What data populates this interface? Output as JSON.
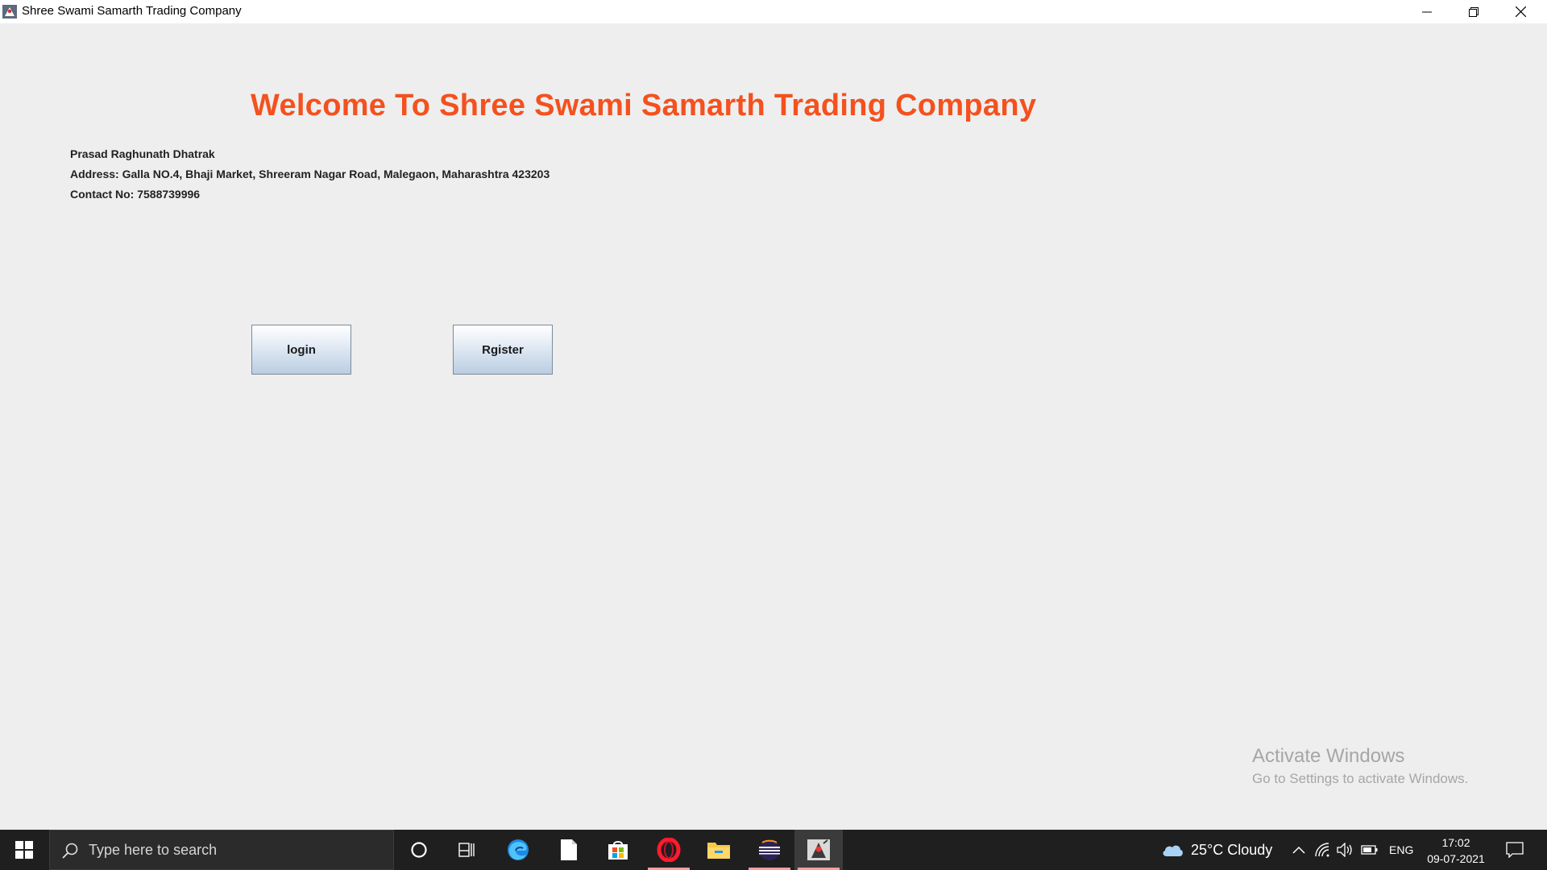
{
  "window": {
    "title": "Shree Swami Samarth Trading Company",
    "icons": {
      "app": "duke-java-icon",
      "minimize": "minimize-icon",
      "maximize": "restore-icon",
      "close": "close-icon"
    }
  },
  "main": {
    "welcome": "Welcome To Shree Swami Samarth Trading Company",
    "owner": "Prasad Raghunath Dhatrak",
    "address": "Address: Galla NO.4, Bhaji Market, Shreeram Nagar Road, Malegaon, Maharashtra 423203",
    "contact": "Contact No: 7588739996",
    "login_label": "login",
    "register_label": "Rgister",
    "accent_color": "#f4511e"
  },
  "watermark": {
    "title": "Activate Windows",
    "subtitle": "Go to Settings to activate Windows."
  },
  "taskbar": {
    "search_placeholder": "Type here to search",
    "weather": "25°C  Cloudy",
    "language": "ENG",
    "time": "17:02",
    "date": "09-07-2021",
    "apps": [
      "cortana-icon",
      "task-view-icon",
      "edge-icon",
      "notepad-icon",
      "store-icon",
      "opera-icon",
      "file-explorer-icon",
      "eclipse-icon",
      "java-app-icon"
    ]
  }
}
